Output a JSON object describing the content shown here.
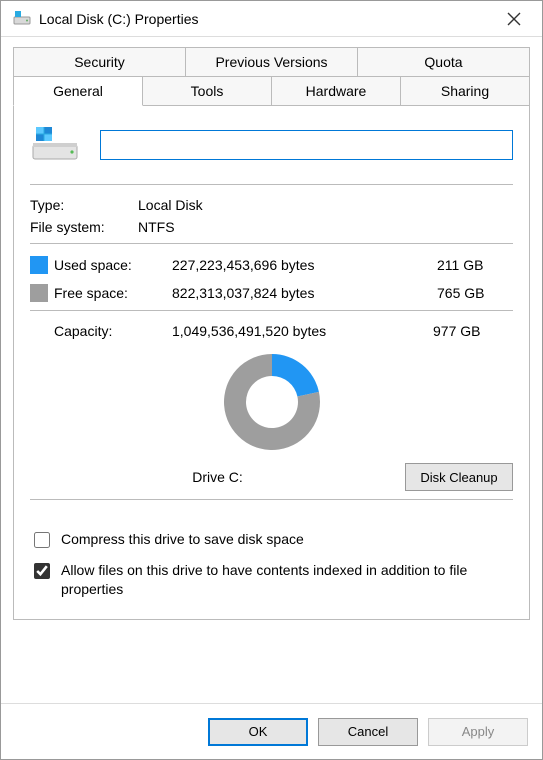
{
  "window": {
    "title": "Local Disk (C:) Properties"
  },
  "tabs": {
    "row1": [
      "Security",
      "Previous Versions",
      "Quota"
    ],
    "row2": [
      "General",
      "Tools",
      "Hardware",
      "Sharing"
    ],
    "active": "General"
  },
  "general": {
    "name_value": "",
    "type_label": "Type:",
    "type_value": "Local Disk",
    "fs_label": "File system:",
    "fs_value": "NTFS",
    "used_label": "Used space:",
    "used_bytes": "227,223,453,696 bytes",
    "used_gb": "211 GB",
    "free_label": "Free space:",
    "free_bytes": "822,313,037,824 bytes",
    "free_gb": "765 GB",
    "capacity_label": "Capacity:",
    "capacity_bytes": "1,049,536,491,520 bytes",
    "capacity_gb": "977 GB",
    "drive_label": "Drive C:",
    "disk_cleanup": "Disk Cleanup",
    "compress_label": "Compress this drive to save disk space",
    "compress_checked": false,
    "index_label": "Allow files on this drive to have contents indexed in addition to file properties",
    "index_checked": true
  },
  "buttons": {
    "ok": "OK",
    "cancel": "Cancel",
    "apply": "Apply"
  },
  "colors": {
    "used": "#2196f3",
    "free": "#9e9e9e",
    "accent": "#0078d7"
  },
  "chart_data": {
    "type": "pie",
    "title": "",
    "series": [
      {
        "name": "Used space",
        "value": 211,
        "unit": "GB",
        "color": "#2196f3"
      },
      {
        "name": "Free space",
        "value": 765,
        "unit": "GB",
        "color": "#9e9e9e"
      }
    ],
    "total": {
      "label": "Capacity",
      "value": 977,
      "unit": "GB"
    }
  }
}
